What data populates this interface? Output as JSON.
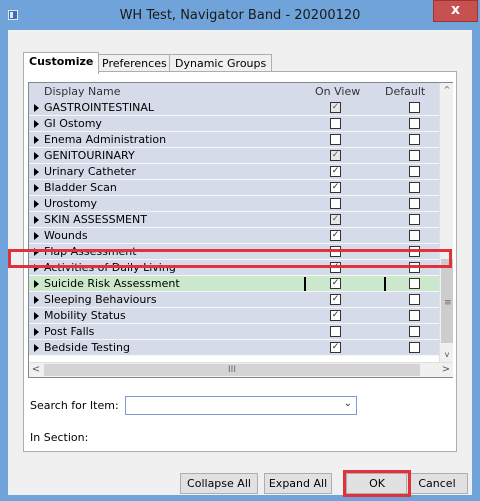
{
  "window": {
    "title": "WH Test, Navigator Band - 20200120",
    "close_label": "x"
  },
  "tabs": [
    "Customize",
    "Preferences",
    "Dynamic Groups"
  ],
  "columns": {
    "display_name": "Display Name",
    "on_view": "On View",
    "default_open": "Default Open"
  },
  "rows": [
    {
      "name": "GASTROINTESTINAL",
      "on_view": true,
      "default_open": false,
      "dim": true
    },
    {
      "name": "GI Ostomy",
      "on_view": false,
      "default_open": false
    },
    {
      "name": "Enema Administration",
      "on_view": false,
      "default_open": false
    },
    {
      "name": "GENITOURINARY",
      "on_view": true,
      "default_open": false,
      "dim": true
    },
    {
      "name": "Urinary Catheter",
      "on_view": true,
      "default_open": false
    },
    {
      "name": "Bladder Scan",
      "on_view": true,
      "default_open": false
    },
    {
      "name": "Urostomy",
      "on_view": false,
      "default_open": false
    },
    {
      "name": "SKIN ASSESSMENT",
      "on_view": true,
      "default_open": false,
      "dim": true
    },
    {
      "name": "Wounds",
      "on_view": true,
      "default_open": false
    },
    {
      "name": "Flap Assessment",
      "on_view": false,
      "default_open": false
    },
    {
      "name": "Activities of Daily Living",
      "on_view": true,
      "default_open": false
    },
    {
      "name": "Suicide Risk Assessment",
      "on_view": true,
      "default_open": false,
      "highlight": true
    },
    {
      "name": "Sleeping Behaviours",
      "on_view": true,
      "default_open": false
    },
    {
      "name": "Mobility Status",
      "on_view": true,
      "default_open": false
    },
    {
      "name": "Post Falls",
      "on_view": false,
      "default_open": false
    },
    {
      "name": "Bedside Testing",
      "on_view": true,
      "default_open": false
    }
  ],
  "scroll": {
    "h_thumb_label": "III",
    "v_thumb_label": "≡"
  },
  "search": {
    "label": "Search for Item:",
    "value": ""
  },
  "section": {
    "label": "In Section:"
  },
  "buttons": {
    "collapse_all": "Collapse All",
    "expand_all": "Expand All",
    "ok": "OK",
    "cancel": "Cancel"
  },
  "colors": {
    "highlight_outline": "#e0323a",
    "row_bg": "#d6dbe9",
    "highlight_row_bg": "#cce8cc",
    "title_bar": "#6fa3d9"
  }
}
